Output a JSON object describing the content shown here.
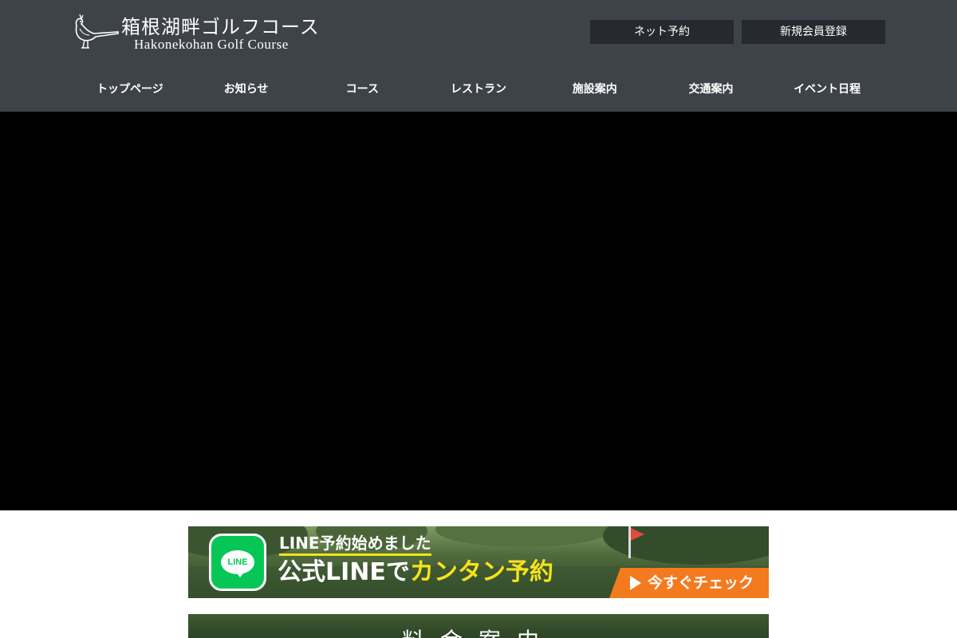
{
  "header": {
    "logo_jp": "箱根湖畔ゴルフコース",
    "logo_en": "Hakonekohan Golf Course",
    "net_reservation_label": "ネット予約",
    "new_member_label": "新規会員登録",
    "bg_color": "#3e4249",
    "button_color": "#26292d"
  },
  "nav": {
    "items": [
      {
        "label": "トップページ"
      },
      {
        "label": "お知らせ"
      },
      {
        "label": "コース"
      },
      {
        "label": "レストラン"
      },
      {
        "label": "施設案内"
      },
      {
        "label": "交通案内"
      },
      {
        "label": "イベント日程"
      }
    ]
  },
  "hero": {
    "bg_color": "#000000"
  },
  "line_banner": {
    "icon_text": "LINE",
    "line1": "LINE予約始めました",
    "line2_prefix": "公式LINEで",
    "line2_highlight": "カンタン予約",
    "cta": "今すぐチェック",
    "line_green": "#06c755",
    "highlight_color": "#f7e21b",
    "cta_color": "#f47a20",
    "icons": [
      "line-app-icon",
      "play-triangle-icon"
    ]
  },
  "price_banner": {
    "title": "料金案内"
  }
}
